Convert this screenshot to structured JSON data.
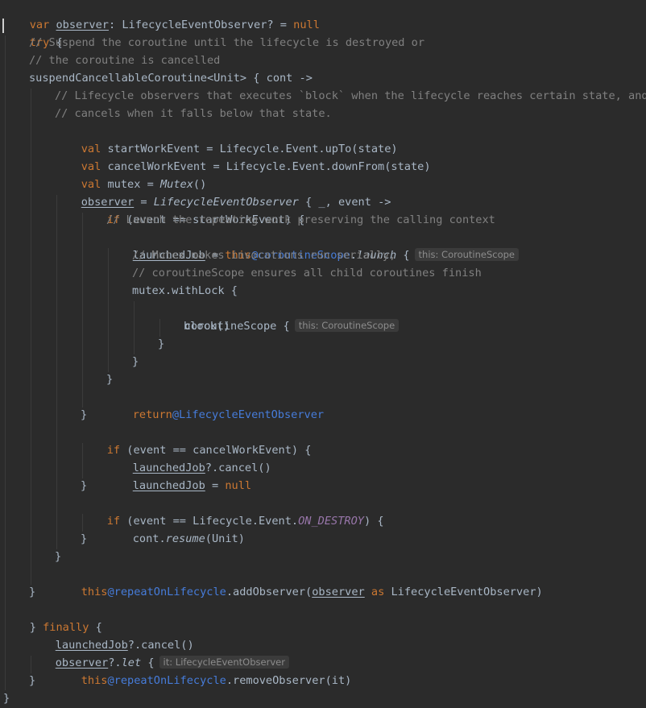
{
  "code": {
    "l1": {
      "kw_var": "var",
      "name": "observer",
      "type": ": LifecycleEventObserver? = ",
      "kw_null": "null"
    },
    "l2": {
      "kw_try": "try",
      "rest": " {"
    },
    "l3": {
      "comment": "// Suspend the coroutine until the lifecycle is destroyed or"
    },
    "l4": {
      "comment": "// the coroutine is cancelled"
    },
    "l5": {
      "text": "suspendCancellableCoroutine<Unit> { cont ->"
    },
    "l6": {
      "comment": "// Lifecycle observers that executes `block` when the lifecycle reaches certain state, and"
    },
    "l7": {
      "comment": "// cancels when it falls below that state."
    },
    "l8": {
      "kw": "val",
      "rest": " startWorkEvent = Lifecycle.Event.upTo(state)"
    },
    "l9": {
      "kw": "val",
      "rest": " cancelWorkEvent = Lifecycle.Event.downFrom(state)"
    },
    "l10": {
      "kw": "val",
      "mid": " mutex = ",
      "fn": "Mutex",
      "end": "()"
    },
    "l11": {
      "name": "observer",
      "mid": " = ",
      "fn": "LifecycleEventObserver",
      "end": " { _, event ->"
    },
    "l12": {
      "kw": "if",
      "rest": " (event == startWorkEvent) {"
    },
    "l13": {
      "comment": "// Launch the repeating work preserving the calling context"
    },
    "l14": {
      "name": "launchedJob",
      "mid": " = ",
      "kw_this": "this",
      "label": "@coroutineScope",
      "dot": ".",
      "fn": "launch",
      "end": " {",
      "hint": "this: CoroutineScope"
    },
    "l15": {
      "comment": "// Mutex makes invocations run serially,"
    },
    "l16": {
      "comment": "// coroutineScope ensures all child coroutines finish"
    },
    "l17": {
      "text": "mutex.withLock {"
    },
    "l18": {
      "text": "coroutineScope {",
      "hint": "this: CoroutineScope"
    },
    "l19": {
      "text": "block()"
    },
    "l20": {
      "text": "}"
    },
    "l21": {
      "text": "}"
    },
    "l22": {
      "text": "}"
    },
    "l23": {
      "kw_return": "return",
      "label": "@LifecycleEventObserver"
    },
    "l24": {
      "text": "}"
    },
    "l25": {
      "kw": "if",
      "rest": " (event == cancelWorkEvent) {"
    },
    "l26": {
      "name": "launchedJob",
      "rest": "?.cancel()"
    },
    "l27": {
      "name": "launchedJob",
      "mid": " = ",
      "kw_null": "null"
    },
    "l28": {
      "text": "}"
    },
    "l29": {
      "kw": "if",
      "mid": " (event == Lifecycle.Event.",
      "const": "ON_DESTROY",
      "end": ") {"
    },
    "l30": {
      "pre": "cont.",
      "fn": "resume",
      "end": "(Unit)"
    },
    "l31": {
      "text": "}"
    },
    "l32": {
      "text": "}"
    },
    "l33": {
      "kw_this": "this",
      "label": "@repeatOnLifecycle",
      "mid": ".addObserver(",
      "name": "observer",
      "kw_as": " as ",
      "end": "LifecycleEventObserver)"
    },
    "l34": {
      "text": "}"
    },
    "l35": {
      "pre": "} ",
      "kw_finally": "finally",
      "end": " {"
    },
    "l36": {
      "name": "launchedJob",
      "rest": "?.cancel()"
    },
    "l37": {
      "name": "observer",
      "mid": "?.",
      "fn": "let",
      "end": " {",
      "hint": "it: LifecycleEventObserver"
    },
    "l38": {
      "kw_this": "this",
      "label": "@repeatOnLifecycle",
      "mid": ".removeObserver(",
      "it": "it",
      "end": ")"
    },
    "l39": {
      "text": "}"
    },
    "l40": {
      "text": "}"
    }
  }
}
